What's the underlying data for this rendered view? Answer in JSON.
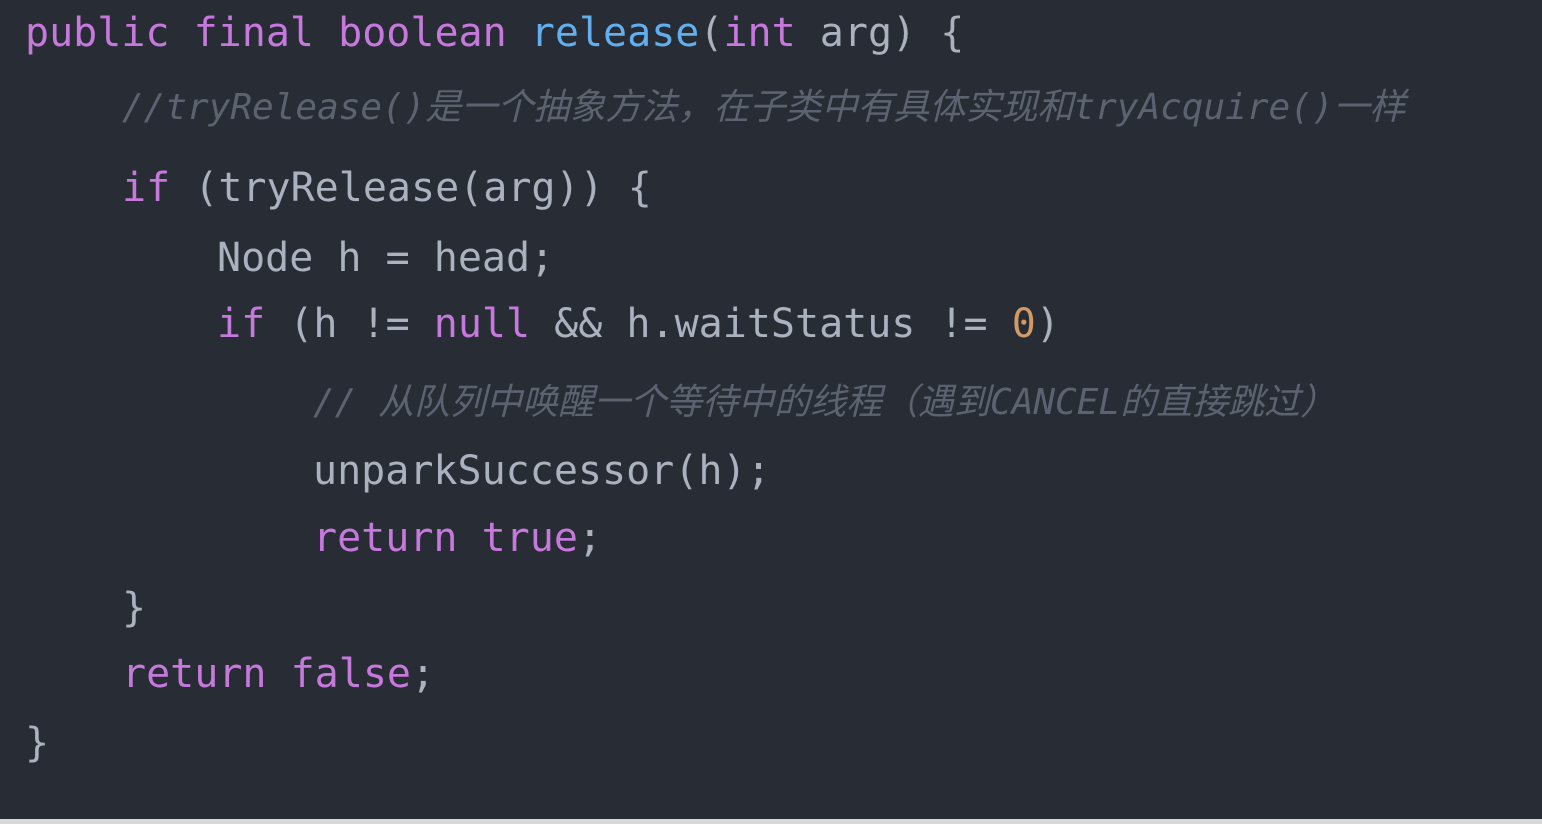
{
  "colors": {
    "background": "#282c34",
    "keyword": "#c678dd",
    "function": "#61afef",
    "text": "#abb2bf",
    "number": "#d19a66",
    "comment": "#5c6370"
  },
  "code_lines": [
    {
      "indent": 0,
      "tokens": [
        {
          "t": "kw",
          "v": "public"
        },
        {
          "t": "tx",
          "v": " "
        },
        {
          "t": "kw",
          "v": "final"
        },
        {
          "t": "tx",
          "v": " "
        },
        {
          "t": "kw",
          "v": "boolean"
        },
        {
          "t": "tx",
          "v": " "
        },
        {
          "t": "fn",
          "v": "release"
        },
        {
          "t": "tx",
          "v": "("
        },
        {
          "t": "kw",
          "v": "int"
        },
        {
          "t": "tx",
          "v": " arg) {"
        }
      ]
    },
    {
      "indent": 1,
      "tokens": [
        {
          "t": "cm",
          "v": "//tryRelease()是一个抽象方法，在子类中有具体实现和tryAcquire()一样"
        }
      ]
    },
    {
      "indent": 1,
      "tokens": [
        {
          "t": "kw",
          "v": "if"
        },
        {
          "t": "tx",
          "v": " (tryRelease(arg)) {"
        }
      ]
    },
    {
      "indent": 2,
      "tokens": [
        {
          "t": "tx",
          "v": "Node h = head;"
        }
      ]
    },
    {
      "indent": 2,
      "tokens": [
        {
          "t": "kw",
          "v": "if"
        },
        {
          "t": "tx",
          "v": " (h != "
        },
        {
          "t": "kw",
          "v": "null"
        },
        {
          "t": "tx",
          "v": " && h.waitStatus != "
        },
        {
          "t": "num",
          "v": "0"
        },
        {
          "t": "tx",
          "v": ")"
        }
      ]
    },
    {
      "indent": 3,
      "tokens": [
        {
          "t": "cm",
          "v": "// 从队列中唤醒一个等待中的线程（遇到CANCEL的直接跳过）"
        }
      ]
    },
    {
      "indent": 3,
      "tokens": [
        {
          "t": "tx",
          "v": "unparkSuccessor(h);"
        }
      ]
    },
    {
      "indent": 3,
      "tokens": [
        {
          "t": "kw",
          "v": "return"
        },
        {
          "t": "tx",
          "v": " "
        },
        {
          "t": "kw",
          "v": "true"
        },
        {
          "t": "tx",
          "v": ";"
        }
      ]
    },
    {
      "indent": 1,
      "tokens": [
        {
          "t": "tx",
          "v": "}"
        }
      ]
    },
    {
      "indent": 1,
      "tokens": [
        {
          "t": "kw",
          "v": "return"
        },
        {
          "t": "tx",
          "v": " "
        },
        {
          "t": "kw",
          "v": "false"
        },
        {
          "t": "tx",
          "v": ";"
        }
      ]
    },
    {
      "indent": 0,
      "tokens": [
        {
          "t": "tx",
          "v": "}"
        }
      ]
    }
  ]
}
